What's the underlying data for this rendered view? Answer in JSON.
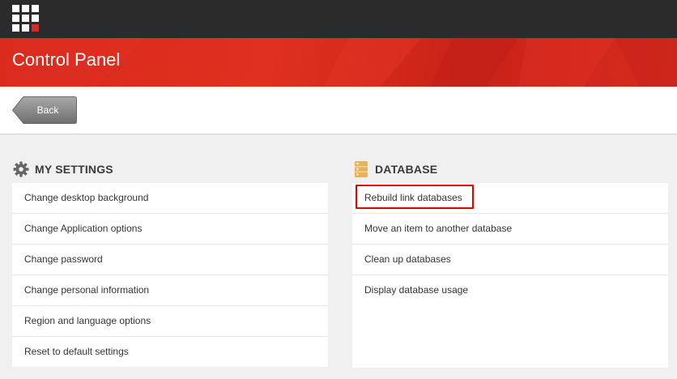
{
  "header": {
    "title": "Control Panel",
    "back_label": "Back"
  },
  "colors": {
    "topbar": "#2b2b2b",
    "banner_red": "#dc291e",
    "highlight": "#e00000"
  },
  "sections": {
    "my_settings": {
      "title": "MY SETTINGS",
      "icon": "gear-icon",
      "items": [
        "Change desktop background",
        "Change Application options",
        "Change password",
        "Change personal information",
        "Region and language options",
        "Reset to default settings"
      ]
    },
    "database": {
      "title": "DATABASE",
      "icon": "database-icon",
      "items": [
        "Rebuild link databases",
        "Move an item to another database",
        "Clean up databases",
        "Display database usage"
      ]
    }
  }
}
